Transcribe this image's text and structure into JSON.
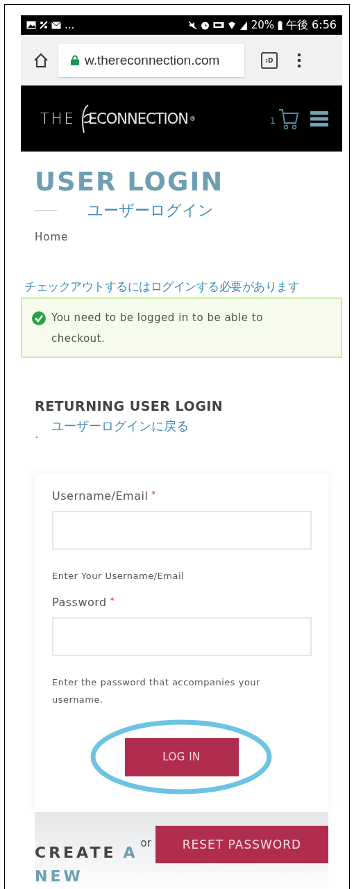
{
  "status_bar": {
    "notifications_more": "...",
    "battery": "20%",
    "time": "午後 6:56"
  },
  "browser": {
    "url": "w.thereconnection.com",
    "tabs_label": ":D"
  },
  "site_header": {
    "logo_left": "THE",
    "logo_right": "ECONNECTION",
    "logo_mark": "®",
    "cart_count": "1"
  },
  "page": {
    "title": "USER LOGIN",
    "title_annotation": "ユーザーログイン",
    "breadcrumb": "Home",
    "notice_annotation": "チェックアウトするにはログインする必要があります",
    "notice": {
      "kind": "success",
      "text": "You need to be logged in to be able to checkout."
    },
    "section_heading": "RETURNING USER LOGIN",
    "section_annotation": "ユーザーログインに戻る",
    "form": {
      "fields": [
        {
          "label": "Username/Email",
          "required_mark": "*",
          "help": "Enter Your Username/Email"
        },
        {
          "label": "Password",
          "required_mark": "*",
          "help": "Enter the password that accompanies your username."
        }
      ],
      "submit": "LOG IN",
      "submit_highlighted": true
    },
    "or": "or",
    "reset_button": "RESET PASSWORD",
    "create_heading": [
      {
        "text": "CREATE",
        "accent": false
      },
      {
        "text": "A",
        "accent": true
      },
      {
        "text": "NEW",
        "accent": true
      }
    ]
  }
}
